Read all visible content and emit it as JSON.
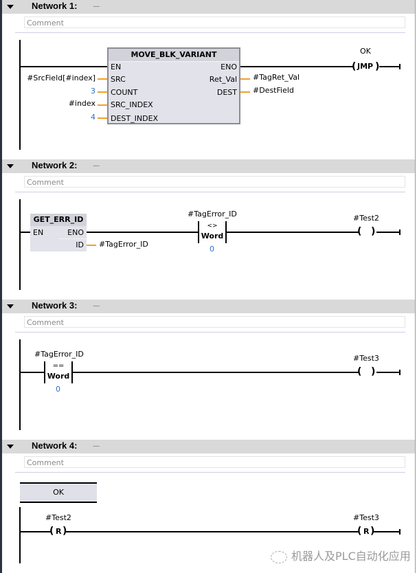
{
  "networks": [
    {
      "title": "Network 1:",
      "dots": ".....",
      "comment_placeholder": "Comment",
      "block": {
        "name": "MOVE_BLK_VARIANT",
        "inputs": [
          {
            "pin": "EN",
            "operand": ""
          },
          {
            "pin": "SRC",
            "operand": "#SrcField[#index]"
          },
          {
            "pin": "COUNT",
            "operand": "3"
          },
          {
            "pin": "SRC_INDEX",
            "operand": "#index"
          },
          {
            "pin": "DEST_INDEX",
            "operand": "4"
          }
        ],
        "outputs": [
          {
            "pin": "ENO",
            "operand": ""
          },
          {
            "pin": "Ret_Val",
            "operand": "#TagRet_Val"
          },
          {
            "pin": "DEST",
            "operand": "#DestField"
          }
        ]
      },
      "coil": {
        "type": "JMP",
        "label": "OK",
        "text": "JMP"
      }
    },
    {
      "title": "Network 2:",
      "dots": ".....",
      "comment_placeholder": "Comment",
      "block": {
        "name": "GET_ERR_ID",
        "inputs": [
          {
            "pin": "EN"
          }
        ],
        "outputs": [
          {
            "pin": "ENO",
            "operand": ""
          },
          {
            "pin": "ID",
            "operand": "#TagError_ID"
          }
        ]
      },
      "compare": {
        "operand": "#TagError_ID",
        "op": "<>",
        "type": "Word",
        "value": "0"
      },
      "coil": {
        "type": "assign",
        "operand": "#Test2"
      }
    },
    {
      "title": "Network 3:",
      "dots": ".....",
      "comment_placeholder": "Comment",
      "compare": {
        "operand": "#TagError_ID",
        "op": "==",
        "type": "Word",
        "value": "0"
      },
      "coil": {
        "type": "assign",
        "operand": "#Test3"
      }
    },
    {
      "title": "Network 4:",
      "dots": ".....",
      "comment_placeholder": "Comment",
      "jump_label": "OK",
      "reset_coil_1": {
        "operand": "#Test2",
        "text": "R"
      },
      "reset_coil_2": {
        "operand": "#Test3",
        "text": "R"
      }
    }
  ],
  "watermark": "机器人及PLC自动化应用",
  "colors": {
    "header_bg": "#d9d9d9",
    "block_bg": "#e2e2ea",
    "wire": "#000000",
    "param_wire": "#f0a028",
    "constant": "#2f6fd0"
  }
}
